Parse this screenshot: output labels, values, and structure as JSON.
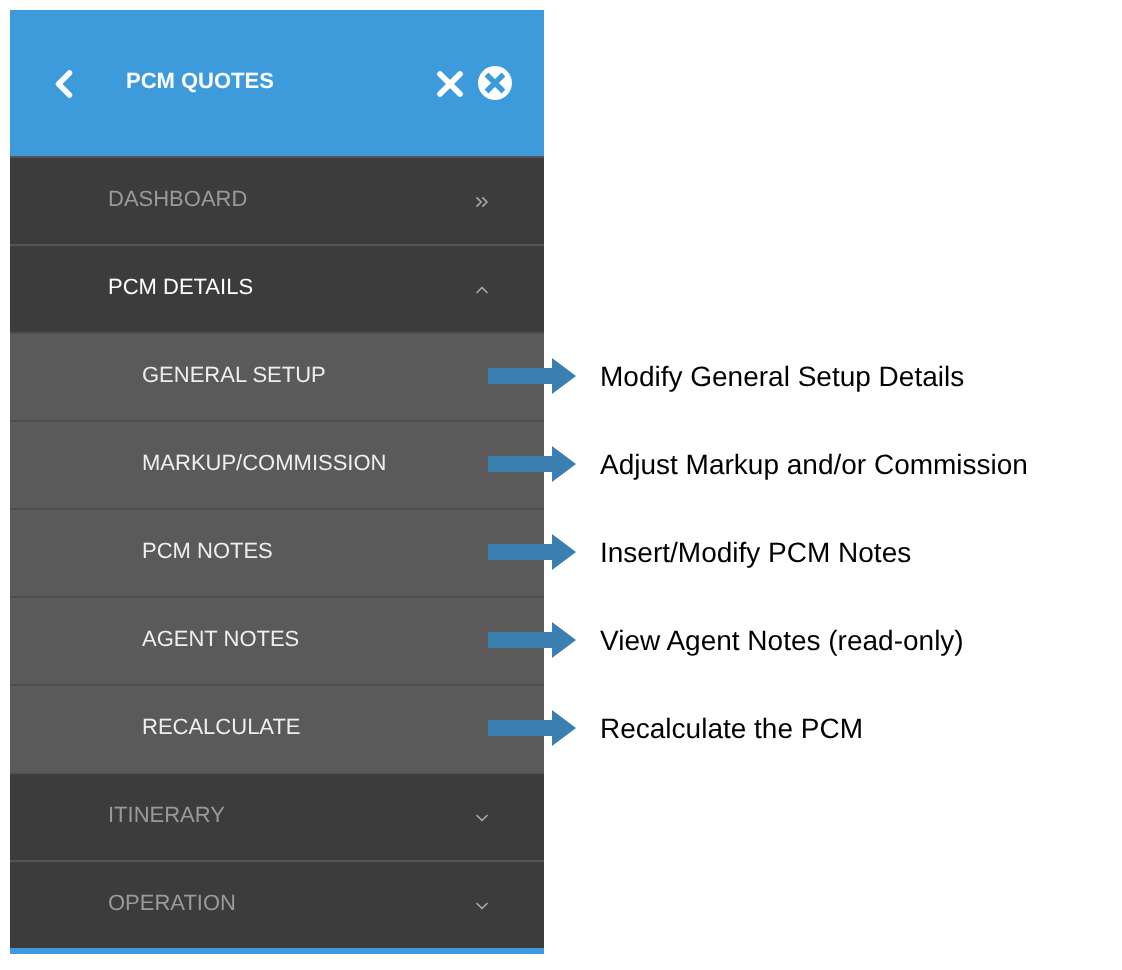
{
  "header": {
    "title": "PCM QUOTES"
  },
  "menu": [
    {
      "label": "DASHBOARD",
      "kind": "link"
    },
    {
      "label": "PCM DETAILS",
      "kind": "group",
      "expanded": true,
      "children": [
        {
          "label": "GENERAL SETUP",
          "note": "Modify General Setup Details"
        },
        {
          "label": "MARKUP/COMMISSION",
          "note": "Adjust Markup and/or Commission"
        },
        {
          "label": "PCM NOTES",
          "note": "Insert/Modify PCM Notes"
        },
        {
          "label": "AGENT NOTES",
          "note": "View Agent Notes (read-only)"
        },
        {
          "label": "RECALCULATE",
          "note": "Recalculate the PCM"
        }
      ]
    },
    {
      "label": "ITINERARY",
      "kind": "group",
      "expanded": false
    },
    {
      "label": "OPERATION",
      "kind": "group",
      "expanded": false
    }
  ]
}
